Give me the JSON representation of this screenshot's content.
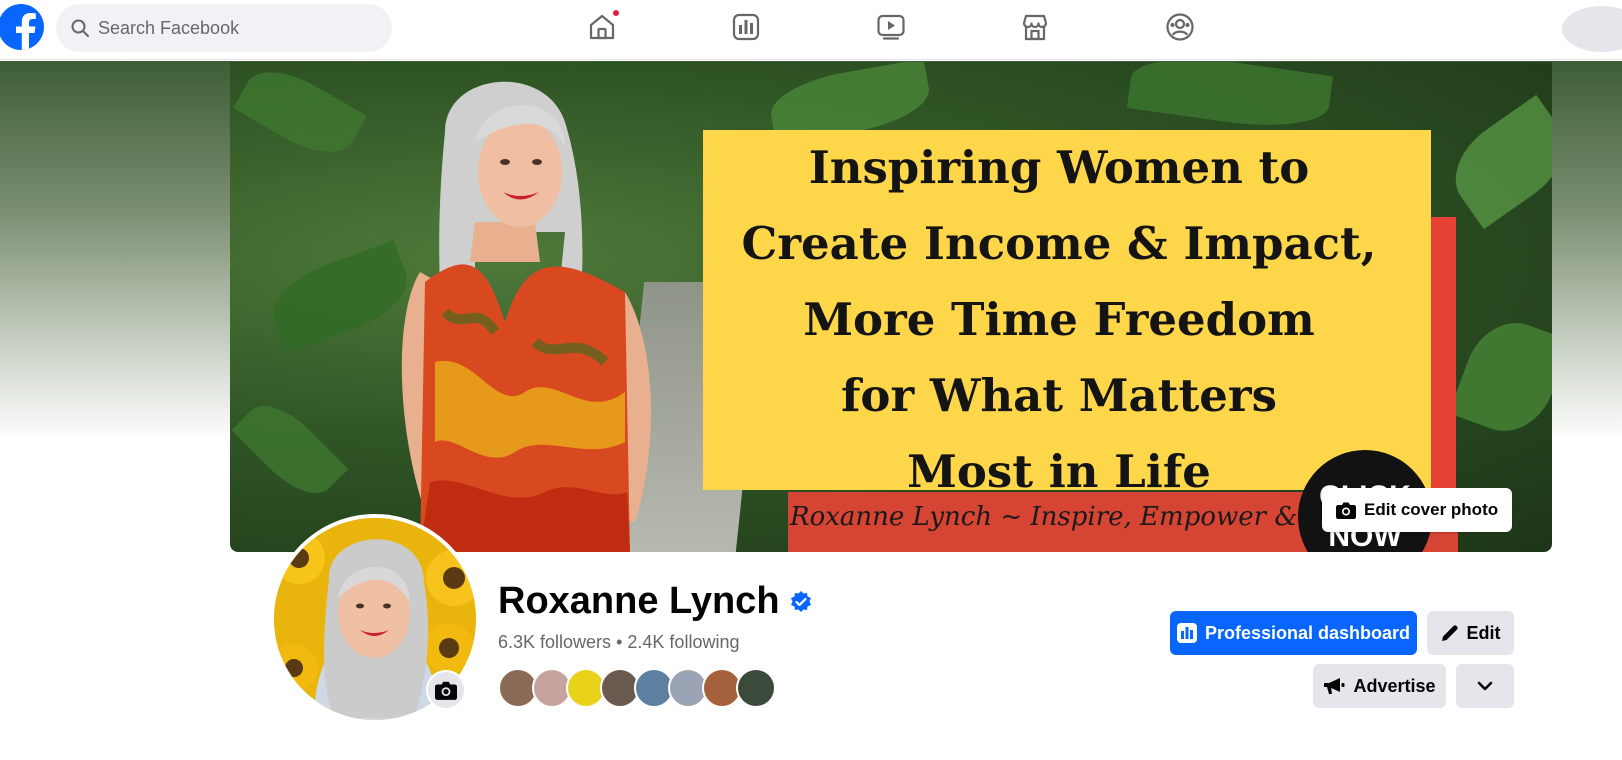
{
  "topbar": {
    "search_placeholder": "Search Facebook",
    "nav_icons": [
      "home-icon",
      "dashboard-icon",
      "video-icon",
      "marketplace-icon",
      "groups-icon"
    ],
    "home_notification": true
  },
  "cover": {
    "headline": [
      "Inspiring Women to",
      "Create Income & Impact,",
      "More Time Freedom",
      "for What Matters",
      "Most in Life"
    ],
    "signature": "Roxanne Lynch ~ Inspire, Empower & Educate",
    "badge_line1": "CLICK",
    "badge_line2": "NOW",
    "edit_cover_label": "Edit cover photo"
  },
  "profile": {
    "name": "Roxanne Lynch",
    "verified": true,
    "followers": "6.3K followers",
    "separator": "•",
    "following": "2.4K following",
    "friend_avatar_count": 8
  },
  "actions": {
    "professional_dashboard": "Professional dashboard",
    "edit": "Edit",
    "advertise": "Advertise"
  },
  "colors": {
    "brand_blue": "#0866ff",
    "button_grey": "#e4e6eb",
    "text_secondary": "#65676b",
    "cover_yellow": "#fdd64a",
    "cover_red": "#e84136"
  }
}
